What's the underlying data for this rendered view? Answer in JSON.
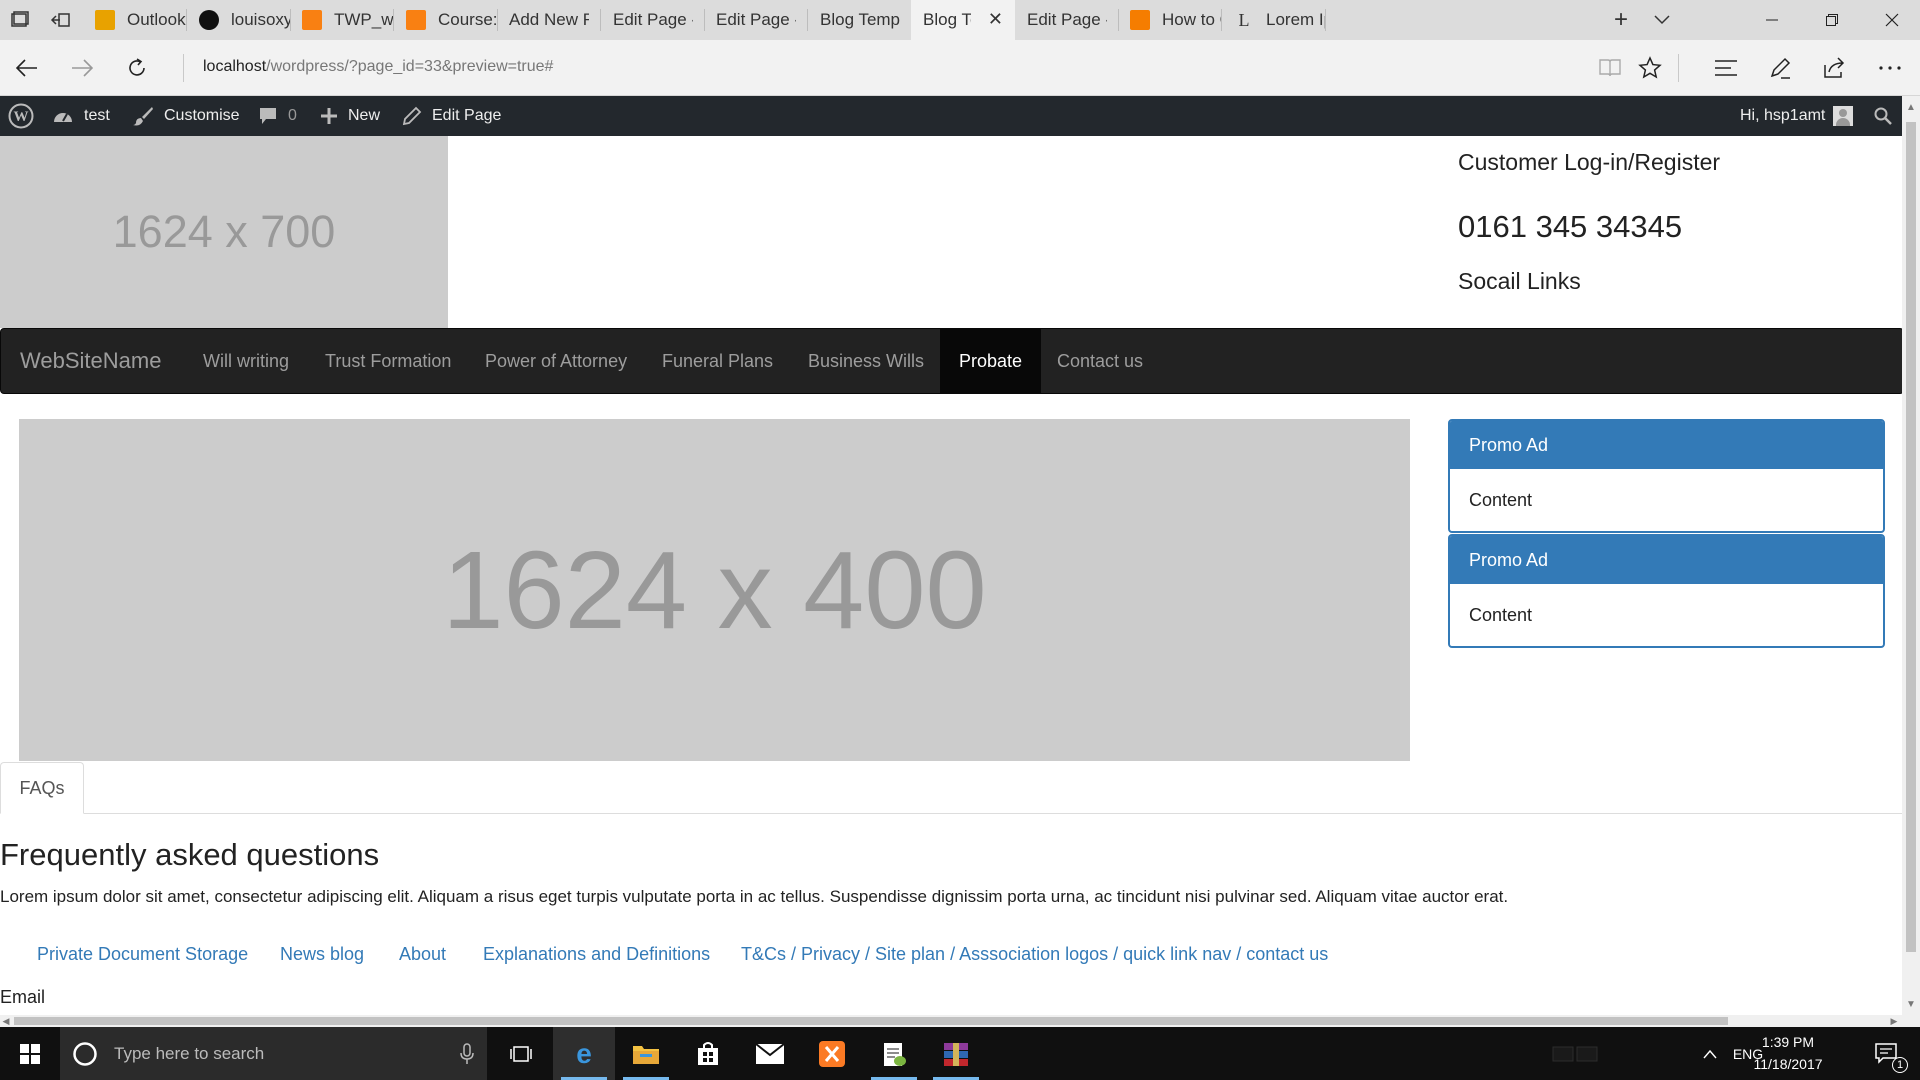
{
  "browser": {
    "tabs": [
      {
        "label": "Outlook W",
        "icon": "outlook-icon",
        "color": "#e8a200"
      },
      {
        "label": "louisoxy/Sc",
        "icon": "github-icon",
        "color": "#111111"
      },
      {
        "label": "TWP_webs",
        "icon": "moodle-icon",
        "color": "#f98012"
      },
      {
        "label": "Course: Wе",
        "icon": "moodle-icon",
        "color": "#f98012"
      },
      {
        "label": "Add New F",
        "icon": "page-icon"
      },
      {
        "label": "Edit Page ‹",
        "icon": "page-icon"
      },
      {
        "label": "Edit Page ‹",
        "icon": "page-icon"
      },
      {
        "label": "Blog Temp",
        "icon": "page-icon"
      },
      {
        "label": "Blog Te",
        "icon": "page-icon",
        "active": true
      },
      {
        "label": "Edit Page ‹",
        "icon": "page-icon"
      },
      {
        "label": "How to Cre",
        "icon": "blogger-icon",
        "color": "#f57d00"
      },
      {
        "label": "Lorem Ipsu",
        "icon": "lorem-icon"
      }
    ],
    "url_host": "localhost",
    "url_path": "/wordpress/?page_id=33&preview=true#"
  },
  "adminbar": {
    "site_name": "test",
    "customise": "Customise",
    "comments": "0",
    "new": "New",
    "edit_page": "Edit Page",
    "greeting": "Hi, hsp1amt"
  },
  "header": {
    "placeholder": "1624 x 700",
    "login": "Customer Log-in/Register",
    "phone": "0161 345 34345",
    "social": "Socail Links"
  },
  "navbar": {
    "brand": "WebSiteName",
    "items": [
      "Will writing",
      "Trust Formation",
      "Power of Attorney",
      "Funeral Plans",
      "Business Wills",
      "Probate",
      "Contact us"
    ],
    "active_index": 5
  },
  "hero": {
    "placeholder": "1624 x 400"
  },
  "promos": [
    {
      "title": "Promo Ad",
      "body": "Content"
    },
    {
      "title": "Promo Ad",
      "body": "Content"
    }
  ],
  "faq": {
    "tab": "FAQs",
    "title": "Frequently asked questions",
    "text": "Lorem ipsum dolor sit amet, consectetur adipiscing elit. Aliquam a risus eget turpis vulputate porta in ac tellus. Suspendisse dignissim porta urna, ac tincidunt nisi pulvinar sed. Aliquam vitae auctor erat."
  },
  "footer": {
    "links": [
      "Private Document Storage",
      "News blog",
      "About",
      "Explanations and Definitions",
      "T&Cs / Privacy / Site plan / Asssociation logos / quick link nav / contact us"
    ],
    "email_label": "Email"
  },
  "taskbar": {
    "search_placeholder": "Type here to search",
    "language": "ENG",
    "time": "1:39 PM",
    "date": "11/18/2017",
    "notification_count": "1"
  },
  "colors": {
    "primary": "#337ab7",
    "navbar_bg": "#222222",
    "adminbar_bg": "#23282d",
    "placeholder_bg": "#cccccc"
  }
}
